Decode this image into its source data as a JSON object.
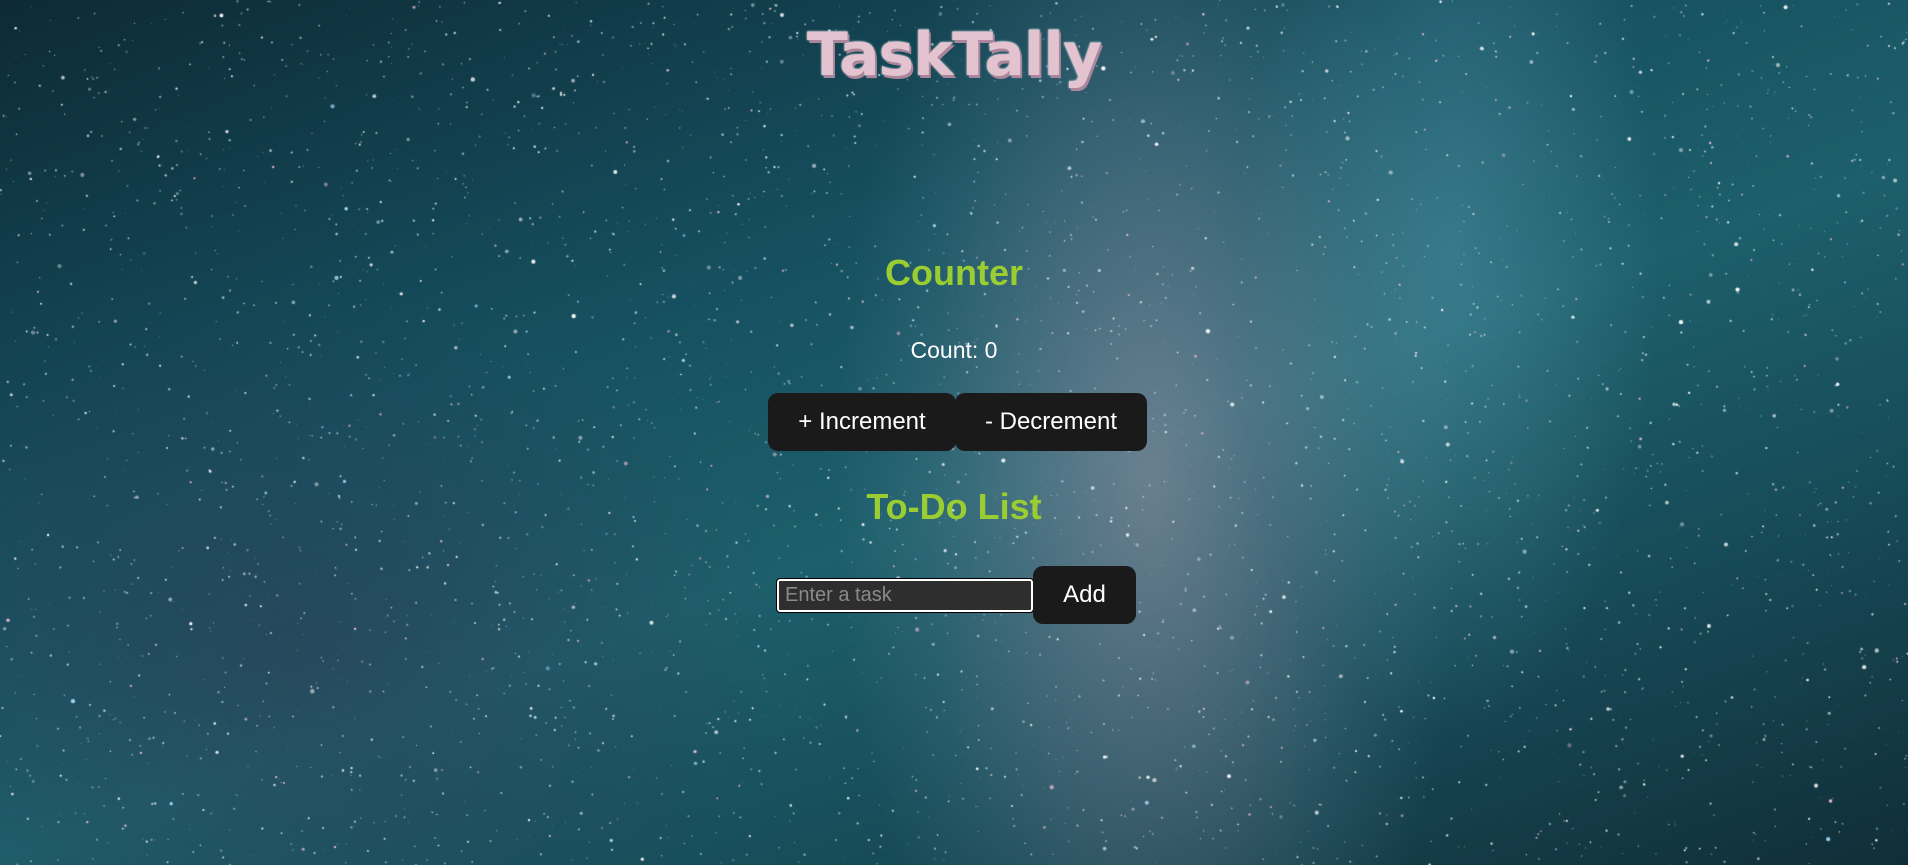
{
  "app": {
    "title": "TaskTally"
  },
  "counter": {
    "heading": "Counter",
    "count_label": "Count:",
    "count_value": "0",
    "increment_label": "+ Increment",
    "decrement_label": "- Decrement"
  },
  "todo": {
    "heading": "To-Do List",
    "input_placeholder": "Enter a task",
    "input_value": "",
    "add_label": "Add"
  },
  "colors": {
    "heading_green": "#9acd32",
    "title_pink": "#e3c3cf",
    "button_bg": "#1a1a1a",
    "button_text": "#ffffff"
  }
}
